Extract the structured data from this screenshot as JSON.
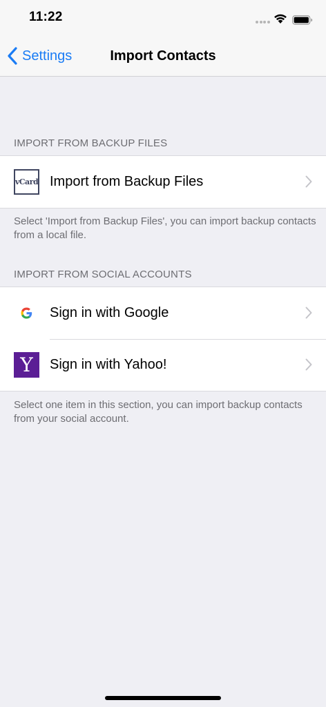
{
  "status_bar": {
    "time": "11:22"
  },
  "nav": {
    "back_label": "Settings",
    "title": "Import Contacts"
  },
  "sections": [
    {
      "header": "IMPORT FROM BACKUP FILES",
      "items": [
        {
          "label": "Import from Backup Files",
          "icon": "vcard-icon",
          "icon_text": "vCard"
        }
      ],
      "footer": "Select 'Import from Backup Files', you can import backup contacts from a local file."
    },
    {
      "header": "IMPORT FROM SOCIAL ACCOUNTS",
      "items": [
        {
          "label": "Sign in with Google",
          "icon": "google-icon"
        },
        {
          "label": "Sign in with Yahoo!",
          "icon": "yahoo-icon",
          "icon_text": "Y"
        }
      ],
      "footer": "Select one item in this section, you can import backup contacts from your social account."
    }
  ],
  "colors": {
    "accent": "#1a7cf5",
    "background": "#efeff4",
    "secondary_text": "#6d6d72",
    "yahoo_purple": "#5b1e95",
    "vcard_border": "#3f4560"
  }
}
